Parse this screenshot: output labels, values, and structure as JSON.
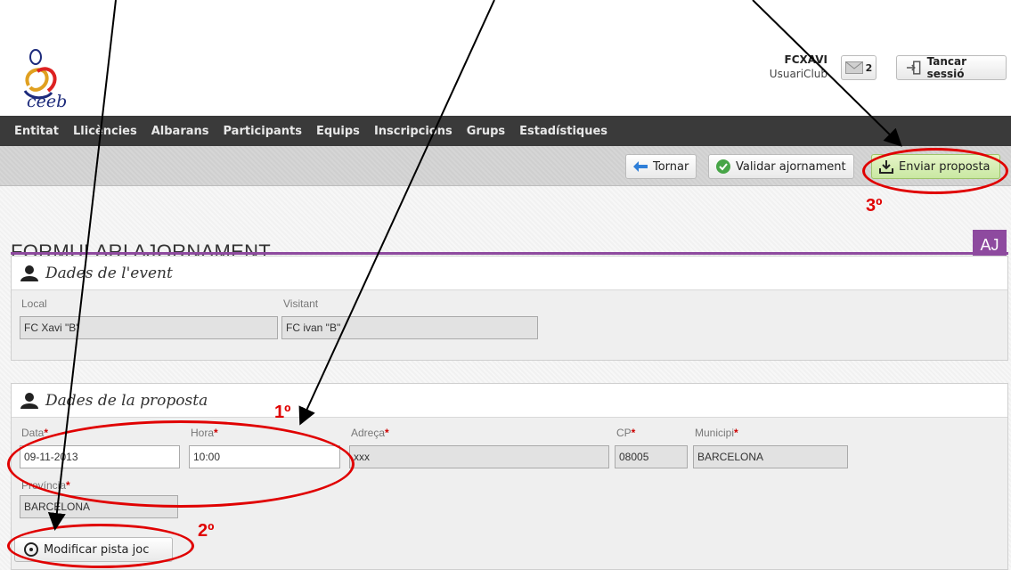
{
  "header": {
    "logo_text": "ceeb",
    "user_name": "FCXAVI",
    "user_role": "UsuariClub",
    "messages_count": "2",
    "logout_label": "Tancar sessió"
  },
  "nav": {
    "items": [
      "Entitat",
      "Llicències",
      "Albarans",
      "Participants",
      "Equips",
      "Inscripcions",
      "Grups",
      "Estadístiques"
    ]
  },
  "toolbar": {
    "back_label": "Tornar",
    "validate_label": "Validar ajornament",
    "send_label": "Enviar proposta"
  },
  "page": {
    "title": "FORMULARI AJORNAMENT",
    "badge": "AJ"
  },
  "event": {
    "title": "Dades de l'event",
    "local_label": "Local",
    "local_value": "FC Xavi \"B\"",
    "visitant_label": "Visitant",
    "visitant_value": "FC ivan \"B\""
  },
  "proposal": {
    "title": "Dades de la proposta",
    "data_label": "Data",
    "data_value": "09-11-2013",
    "hora_label": "Hora",
    "hora_value": "10:00",
    "adreca_label": "Adreça",
    "adreca_value": "xxx",
    "cp_label": "CP",
    "cp_value": "08005",
    "municipi_label": "Municipi",
    "municipi_value": "BARCELONA",
    "provincia_label": "Província",
    "provincia_value": "BARCELONA",
    "required_mark": "*",
    "modify_label": "Modificar pista joc"
  },
  "annotations": {
    "step1": "1º",
    "step2": "2º",
    "step3": "3º",
    "color": "#e00000"
  },
  "colors": {
    "accent_purple": "#8e4a9f",
    "navbar": "#3a3a3a",
    "send_button": "#c9e8a2"
  }
}
